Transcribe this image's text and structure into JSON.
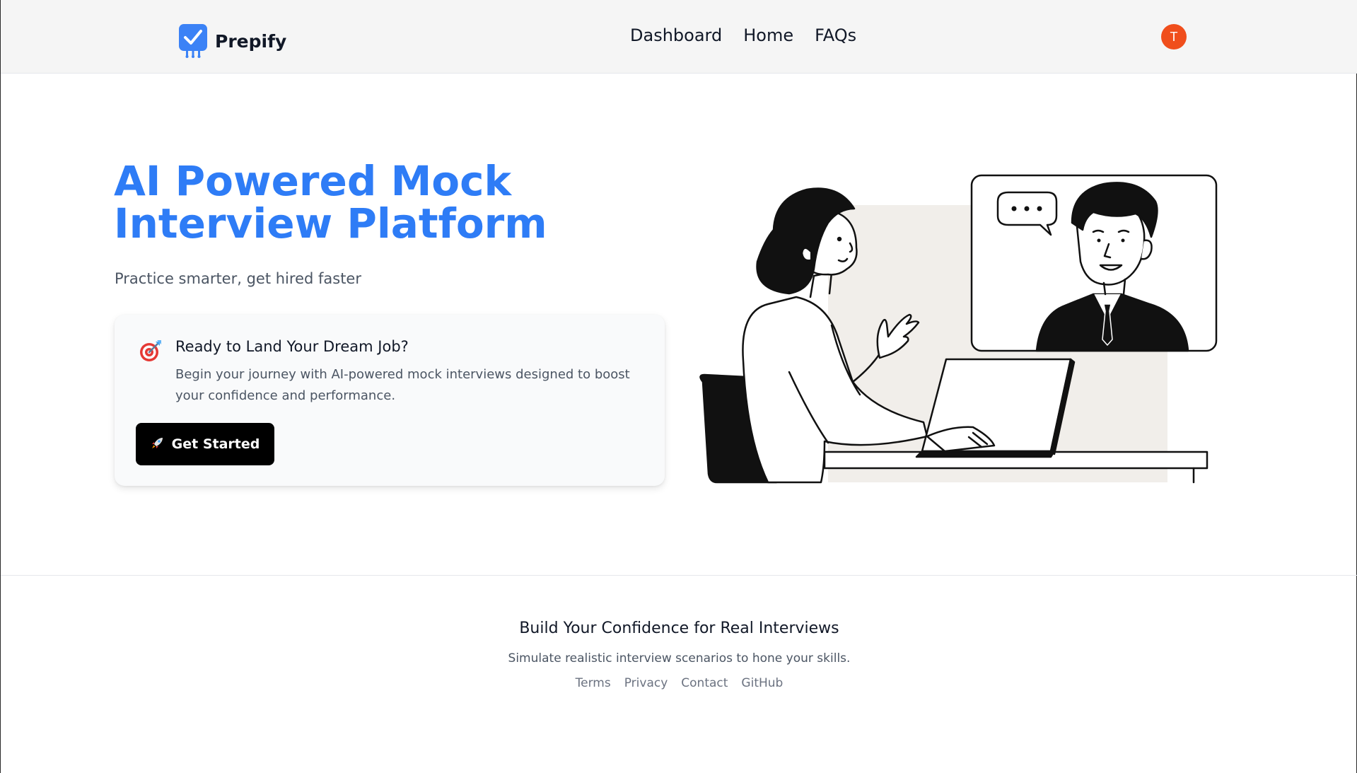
{
  "brand": {
    "name": "Prepify",
    "logo_icon": "check-square-icon",
    "accent": "#3b82f6"
  },
  "nav": {
    "items": [
      {
        "label": "Dashboard"
      },
      {
        "label": "Home"
      },
      {
        "label": "FAQs"
      }
    ]
  },
  "user": {
    "avatar_initial": "T",
    "avatar_color": "#f04e1c"
  },
  "hero": {
    "title": "AI Powered Mock Interview Platform",
    "subtitle": "Practice smarter, get hired faster",
    "title_color": "#2e7cf6"
  },
  "card": {
    "icon": "target-dart-icon",
    "title": "Ready to Land Your Dream Job?",
    "description": "Begin your journey with AI-powered mock interviews designed to boost your confidence and performance.",
    "button_icon": "rocket-icon",
    "button_label": "Get Started"
  },
  "illustration": {
    "subject": "woman on laptop video interview with man"
  },
  "footer": {
    "title": "Build Your Confidence for Real Interviews",
    "subtitle": "Simulate realistic interview scenarios to hone your skills.",
    "links": [
      {
        "label": "Terms"
      },
      {
        "label": "Privacy"
      },
      {
        "label": "Contact"
      },
      {
        "label": "GitHub"
      }
    ]
  }
}
